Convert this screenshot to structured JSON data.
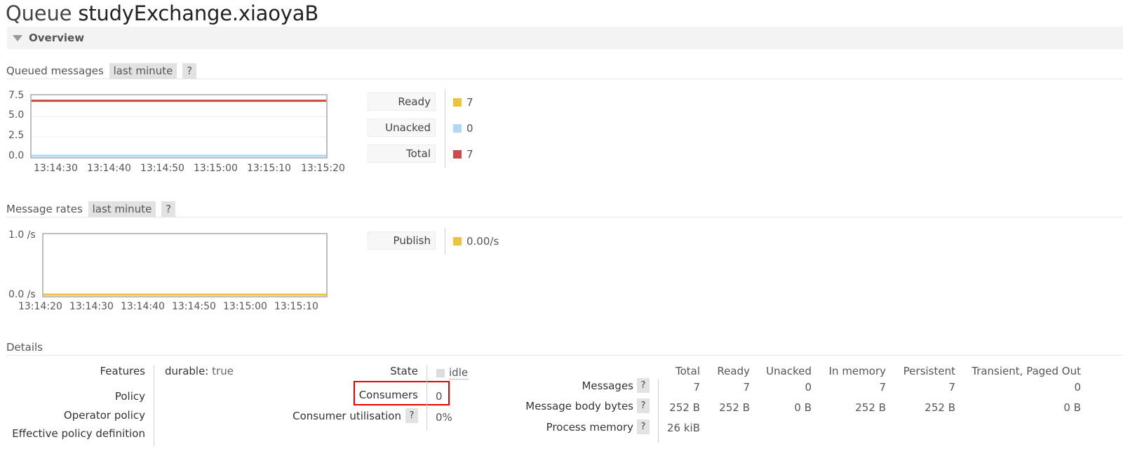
{
  "page": {
    "title_prefix": "Queue",
    "queue_name": "studyExchange.xiaoyaB"
  },
  "overview": {
    "label": "Overview"
  },
  "queued_messages": {
    "heading": "Queued messages",
    "range": "last minute",
    "help": "?",
    "y_ticks": [
      "7.5",
      "5.0",
      "2.5",
      "0.0"
    ],
    "x_ticks": [
      "13:14:30",
      "13:14:40",
      "13:14:50",
      "13:15:00",
      "13:15:10",
      "13:15:20"
    ],
    "legend": [
      {
        "label": "Ready",
        "value": "7",
        "color": "#edc240"
      },
      {
        "label": "Unacked",
        "value": "0",
        "color": "#afd8f8"
      },
      {
        "label": "Total",
        "value": "7",
        "color": "#cb4b4b"
      }
    ]
  },
  "message_rates": {
    "heading": "Message rates",
    "range": "last minute",
    "help": "?",
    "y_ticks": [
      "1.0 /s",
      "0.0 /s"
    ],
    "x_ticks": [
      "13:14:20",
      "13:14:30",
      "13:14:40",
      "13:14:50",
      "13:15:00",
      "13:15:10"
    ],
    "legend": [
      {
        "label": "Publish",
        "value": "0.00/s",
        "color": "#edc240"
      }
    ]
  },
  "chart_data": [
    {
      "type": "line",
      "title": "Queued messages",
      "x": [
        "13:14:30",
        "13:14:40",
        "13:14:50",
        "13:15:00",
        "13:15:10",
        "13:15:20"
      ],
      "ylim": [
        0,
        7.5
      ],
      "series": [
        {
          "name": "Ready",
          "values": [
            7,
            7,
            7,
            7,
            7,
            7
          ],
          "color": "#edc240"
        },
        {
          "name": "Unacked",
          "values": [
            0,
            0,
            0,
            0,
            0,
            0
          ],
          "color": "#afd8f8"
        },
        {
          "name": "Total",
          "values": [
            7,
            7,
            7,
            7,
            7,
            7
          ],
          "color": "#cb4b4b"
        }
      ]
    },
    {
      "type": "line",
      "title": "Message rates",
      "x": [
        "13:14:20",
        "13:14:30",
        "13:14:40",
        "13:14:50",
        "13:15:00",
        "13:15:10"
      ],
      "ylim": [
        0,
        1.0
      ],
      "series": [
        {
          "name": "Publish",
          "values": [
            0,
            0,
            0,
            0,
            0,
            0
          ],
          "color": "#edc240"
        }
      ]
    }
  ],
  "details": {
    "heading": "Details",
    "features_label": "Features",
    "durable_key": "durable:",
    "durable_value": "true",
    "policy_label": "Policy",
    "operator_policy_label": "Operator policy",
    "effective_policy_label": "Effective policy definition",
    "state_label": "State",
    "state_value": "idle",
    "consumers_label": "Consumers",
    "consumers_value": "0",
    "consumer_util_label": "Consumer utilisation",
    "consumer_util_value": "0%",
    "help": "?"
  },
  "stats": {
    "columns": [
      "Total",
      "Ready",
      "Unacked",
      "In memory",
      "Persistent",
      "Transient, Paged Out"
    ],
    "rows": [
      {
        "label": "Messages",
        "values": [
          "7",
          "7",
          "0",
          "7",
          "7",
          "0"
        ]
      },
      {
        "label": "Message body bytes",
        "values": [
          "252 B",
          "252 B",
          "0 B",
          "252 B",
          "252 B",
          "0 B"
        ]
      },
      {
        "label": "Process memory",
        "values": [
          "26 kiB",
          "",
          "",
          "",
          "",
          ""
        ]
      }
    ]
  }
}
